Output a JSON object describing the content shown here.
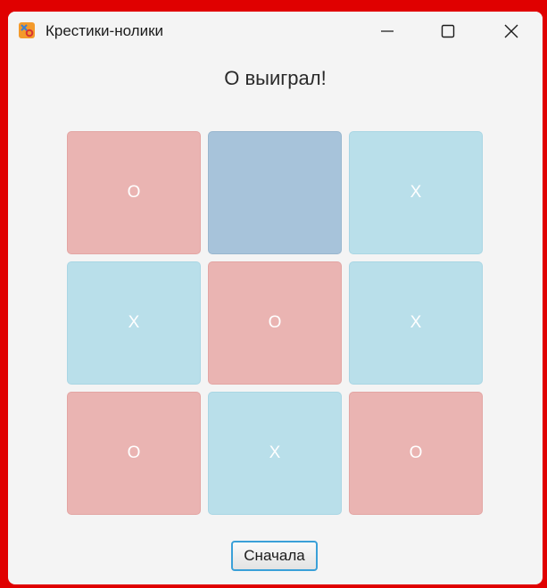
{
  "window": {
    "title": "Крестики-нолики",
    "icon": "tic-tac-toe-app-icon"
  },
  "status": "O выиграл!",
  "board": {
    "cells": [
      {
        "mark": "O",
        "color": "#eab4b2"
      },
      {
        "mark": "",
        "color": "#a7c3da"
      },
      {
        "mark": "X",
        "color": "#b9dfea"
      },
      {
        "mark": "X",
        "color": "#b9dfea"
      },
      {
        "mark": "O",
        "color": "#eab4b2"
      },
      {
        "mark": "X",
        "color": "#b9dfea"
      },
      {
        "mark": "O",
        "color": "#eab4b2"
      },
      {
        "mark": "X",
        "color": "#b9dfea"
      },
      {
        "mark": "O",
        "color": "#eab4b2"
      }
    ]
  },
  "restart_label": "Сначала",
  "colors": {
    "o_cell": "#eab4b2",
    "x_cell": "#b9dfea",
    "empty_cell": "#a7c3da",
    "button_focus": "#3aa0d8"
  }
}
